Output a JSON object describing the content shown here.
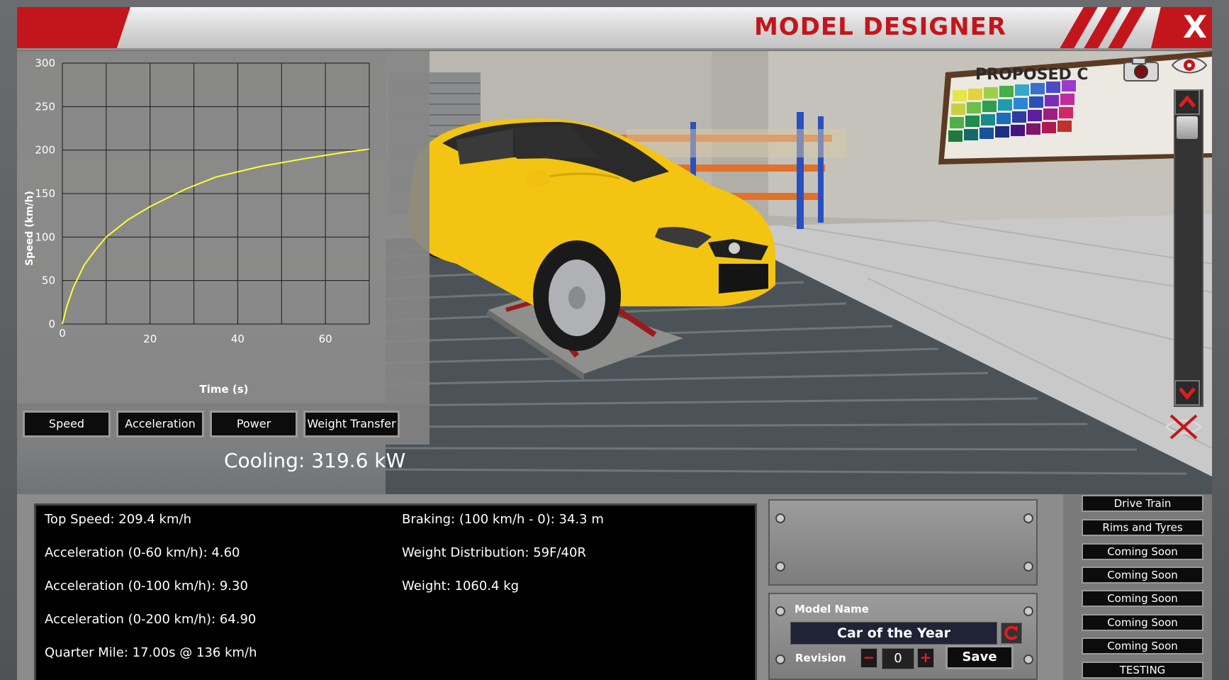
{
  "window": {
    "title": "MODEL DESIGNER",
    "close_label": "X"
  },
  "colors": {
    "accent_red": "#c3161c",
    "car_yellow": "#f3c412",
    "plot_line": "#ffff33"
  },
  "chart_data": {
    "type": "line",
    "xlabel": "Time (s)",
    "ylabel": "Speed (km/h)",
    "xlim": [
      0,
      70
    ],
    "ylim": [
      0,
      300
    ],
    "x_ticks": [
      0,
      20,
      40,
      60
    ],
    "y_ticks": [
      0,
      50,
      100,
      150,
      200,
      250,
      300
    ],
    "grid": true,
    "series": [
      {
        "x": [
          0,
          1,
          2.5,
          5,
          7.5,
          10,
          15,
          20,
          28,
          35,
          45,
          55,
          65,
          70
        ],
        "y": [
          0,
          20,
          42,
          68,
          85,
          100,
          120,
          135,
          155,
          169,
          181,
          190,
          198,
          201
        ]
      }
    ]
  },
  "chart_tabs": [
    "Speed",
    "Acceleration",
    "Power",
    "Weight Transfer"
  ],
  "cooling": "Cooling: 319.6 kW",
  "stats": {
    "left": [
      "Top Speed: 209.4 km/h",
      "Acceleration (0-60 km/h): 4.60",
      "Acceleration (0-100 km/h): 9.30",
      "Acceleration (0-200 km/h): 64.90",
      "Quarter Mile: 17.00s @ 136 km/h"
    ],
    "right": [
      "Braking: (100 km/h - 0): 34.3 m",
      "Weight Distribution: 59F/40R",
      "Weight: 1060.4 kg"
    ]
  },
  "model": {
    "name_label": "Model Name",
    "name_value": "Car of the Year",
    "revision_label": "Revision",
    "revision_value": "0",
    "minus_label": "−",
    "plus_label": "+",
    "save_label": "Save"
  },
  "menu": [
    "Drive Train",
    "Rims and Tyres",
    "Coming Soon",
    "Coming Soon",
    "Coming Soon",
    "Coming Soon",
    "Coming Soon",
    "TESTING"
  ],
  "scene": {
    "board_text": "PROPOSED C"
  }
}
